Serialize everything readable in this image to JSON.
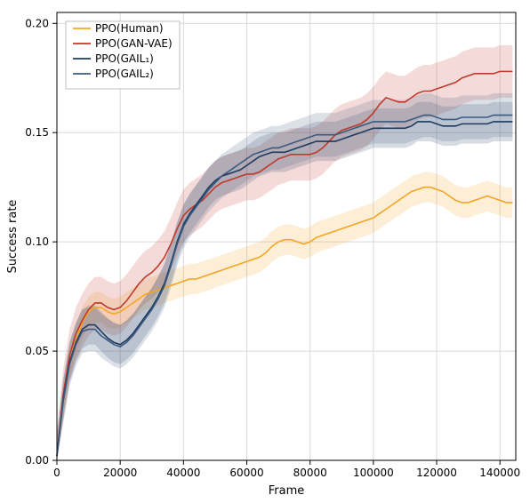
{
  "chart_data": {
    "type": "line",
    "xlabel": "Frame",
    "ylabel": "Success rate",
    "title": "",
    "xlim": [
      0,
      145000
    ],
    "ylim": [
      0.0,
      0.205
    ],
    "xticks": [
      0,
      20000,
      40000,
      60000,
      80000,
      100000,
      120000,
      140000
    ],
    "yticks": [
      0.0,
      0.05,
      0.1,
      0.15,
      0.2
    ],
    "grid": true,
    "legend_position": "upper-left",
    "x": [
      0,
      2000,
      4000,
      6000,
      8000,
      10000,
      12000,
      14000,
      16000,
      18000,
      20000,
      22000,
      24000,
      26000,
      28000,
      30000,
      32000,
      34000,
      36000,
      38000,
      40000,
      42000,
      44000,
      46000,
      48000,
      50000,
      52000,
      54000,
      56000,
      58000,
      60000,
      62000,
      64000,
      66000,
      68000,
      70000,
      72000,
      74000,
      76000,
      78000,
      80000,
      82000,
      84000,
      86000,
      88000,
      90000,
      92000,
      94000,
      96000,
      98000,
      100000,
      102000,
      104000,
      106000,
      108000,
      110000,
      112000,
      114000,
      116000,
      118000,
      120000,
      122000,
      124000,
      126000,
      128000,
      130000,
      132000,
      134000,
      136000,
      138000,
      140000,
      142000,
      144000
    ],
    "series": [
      {
        "name": "PPO(Human)",
        "color": "#f5a623",
        "values": [
          0.002,
          0.028,
          0.045,
          0.055,
          0.063,
          0.068,
          0.07,
          0.07,
          0.068,
          0.067,
          0.068,
          0.07,
          0.072,
          0.074,
          0.076,
          0.077,
          0.078,
          0.079,
          0.08,
          0.081,
          0.082,
          0.083,
          0.083,
          0.084,
          0.085,
          0.086,
          0.087,
          0.088,
          0.089,
          0.09,
          0.091,
          0.092,
          0.093,
          0.095,
          0.098,
          0.1,
          0.101,
          0.101,
          0.1,
          0.099,
          0.1,
          0.102,
          0.103,
          0.104,
          0.105,
          0.106,
          0.107,
          0.108,
          0.109,
          0.11,
          0.111,
          0.113,
          0.115,
          0.117,
          0.119,
          0.121,
          0.123,
          0.124,
          0.125,
          0.125,
          0.124,
          0.123,
          0.121,
          0.119,
          0.118,
          0.118,
          0.119,
          0.12,
          0.121,
          0.12,
          0.119,
          0.118,
          0.118
        ],
        "band": 0.007
      },
      {
        "name": "PPO(GAN-VAE)",
        "color": "#c0392b",
        "values": [
          0.002,
          0.03,
          0.048,
          0.058,
          0.064,
          0.069,
          0.072,
          0.072,
          0.07,
          0.069,
          0.07,
          0.073,
          0.077,
          0.081,
          0.084,
          0.086,
          0.089,
          0.093,
          0.099,
          0.106,
          0.112,
          0.115,
          0.117,
          0.119,
          0.122,
          0.125,
          0.127,
          0.128,
          0.129,
          0.13,
          0.131,
          0.131,
          0.132,
          0.134,
          0.136,
          0.138,
          0.139,
          0.14,
          0.14,
          0.14,
          0.14,
          0.141,
          0.143,
          0.146,
          0.149,
          0.151,
          0.152,
          0.153,
          0.154,
          0.156,
          0.159,
          0.163,
          0.166,
          0.165,
          0.164,
          0.164,
          0.166,
          0.168,
          0.169,
          0.169,
          0.17,
          0.171,
          0.172,
          0.173,
          0.175,
          0.176,
          0.177,
          0.177,
          0.177,
          0.177,
          0.178,
          0.178,
          0.178
        ],
        "band": 0.012
      },
      {
        "name": "PPO(GAIL₁)",
        "color": "#1f3a5f",
        "values": [
          0.002,
          0.028,
          0.045,
          0.054,
          0.06,
          0.062,
          0.062,
          0.059,
          0.056,
          0.054,
          0.053,
          0.055,
          0.058,
          0.062,
          0.066,
          0.07,
          0.075,
          0.081,
          0.09,
          0.1,
          0.108,
          0.113,
          0.117,
          0.121,
          0.125,
          0.128,
          0.13,
          0.131,
          0.132,
          0.133,
          0.135,
          0.137,
          0.139,
          0.14,
          0.141,
          0.141,
          0.141,
          0.142,
          0.143,
          0.144,
          0.145,
          0.146,
          0.146,
          0.146,
          0.146,
          0.147,
          0.148,
          0.149,
          0.15,
          0.151,
          0.152,
          0.152,
          0.152,
          0.152,
          0.152,
          0.152,
          0.153,
          0.155,
          0.155,
          0.155,
          0.154,
          0.153,
          0.153,
          0.153,
          0.154,
          0.154,
          0.154,
          0.154,
          0.154,
          0.155,
          0.155,
          0.155,
          0.155
        ],
        "band": 0.009
      },
      {
        "name": "PPO(GAIL₂)",
        "color": "#3b5a80",
        "values": [
          0.002,
          0.027,
          0.044,
          0.053,
          0.059,
          0.06,
          0.06,
          0.057,
          0.055,
          0.053,
          0.052,
          0.054,
          0.057,
          0.061,
          0.065,
          0.069,
          0.074,
          0.08,
          0.089,
          0.099,
          0.107,
          0.112,
          0.116,
          0.12,
          0.124,
          0.127,
          0.13,
          0.132,
          0.134,
          0.136,
          0.138,
          0.14,
          0.141,
          0.142,
          0.143,
          0.143,
          0.144,
          0.145,
          0.146,
          0.147,
          0.148,
          0.149,
          0.149,
          0.149,
          0.149,
          0.15,
          0.151,
          0.152,
          0.153,
          0.154,
          0.155,
          0.155,
          0.155,
          0.155,
          0.155,
          0.155,
          0.156,
          0.157,
          0.158,
          0.158,
          0.157,
          0.156,
          0.156,
          0.156,
          0.157,
          0.157,
          0.157,
          0.157,
          0.157,
          0.158,
          0.158,
          0.158,
          0.158
        ],
        "band": 0.01
      }
    ]
  }
}
